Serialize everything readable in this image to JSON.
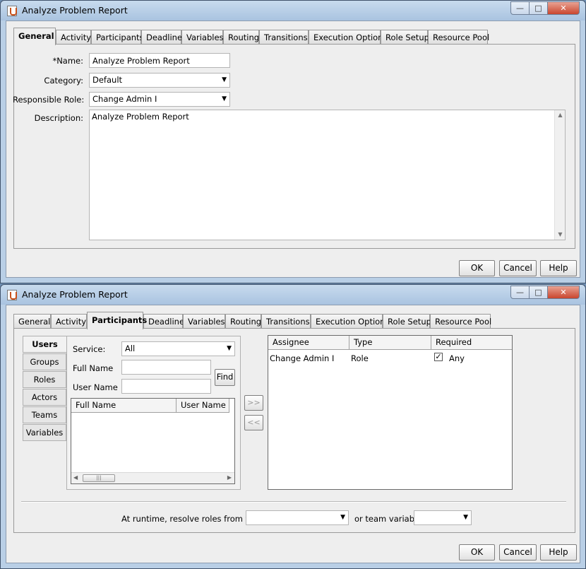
{
  "window1": {
    "title": "Analyze Problem Report",
    "tabs": [
      "General",
      "Activity",
      "Participants",
      "Deadline",
      "Variables",
      "Routing",
      "Transitions",
      "Execution Options",
      "Role Setup",
      "Resource Pool"
    ],
    "active_tab": "General",
    "form": {
      "name_label": "*Name:",
      "name_value": "Analyze Problem Report",
      "category_label": "Category:",
      "category_value": "Default",
      "role_label": "Responsible Role:",
      "role_value": "Change Admin I",
      "description_label": "Description:",
      "description_value": "Analyze Problem Report"
    },
    "buttons": {
      "ok": "OK",
      "cancel": "Cancel",
      "help": "Help"
    }
  },
  "window2": {
    "title": "Analyze Problem Report",
    "tabs": [
      "General",
      "Activity",
      "Participants",
      "Deadline",
      "Variables",
      "Routing",
      "Transitions",
      "Execution Options",
      "Role Setup",
      "Resource Pool"
    ],
    "active_tab": "Participants",
    "side_tabs": [
      "Users",
      "Groups",
      "Roles",
      "Actors",
      "Teams",
      "Variables"
    ],
    "active_side_tab": "Users",
    "search": {
      "service_label": "Service:",
      "service_value": "All",
      "fullname_label": "Full Name",
      "username_label": "User Name",
      "find_label": "Find"
    },
    "users_table": {
      "columns": [
        "Full Name",
        "User Name"
      ]
    },
    "move_right": ">>",
    "move_left": "<<",
    "assignee_table": {
      "columns": [
        "Assignee",
        "Type",
        "Required"
      ],
      "rows": [
        {
          "assignee": "Change Admin I",
          "type": "Role",
          "required_checked": true,
          "required_text": "Any"
        }
      ]
    },
    "runtime_label": "At runtime, resolve roles from team",
    "team_value": "",
    "team_variable_label": "or team variable",
    "team_variable_value": "",
    "buttons": {
      "ok": "OK",
      "cancel": "Cancel",
      "help": "Help"
    }
  },
  "colors": {
    "title_bar": "#b9cfe6",
    "panel": "#eeeeee",
    "close_button": "#c9462e"
  }
}
